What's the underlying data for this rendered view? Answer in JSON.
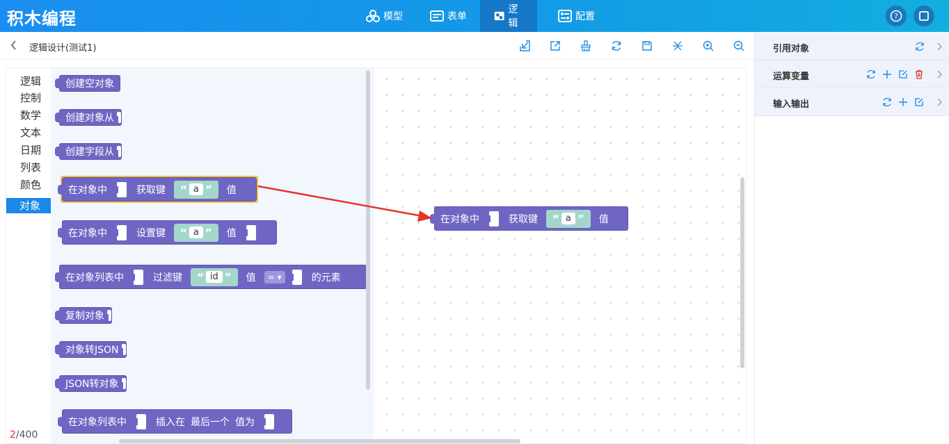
{
  "app": {
    "title": "积木编程"
  },
  "nav": {
    "tabs": [
      {
        "label": "模型",
        "icon": "model-icon"
      },
      {
        "label": "表单",
        "icon": "form-icon"
      },
      {
        "label": "逻辑",
        "icon": "logic-icon",
        "active": true
      },
      {
        "label": "配置",
        "icon": "config-icon"
      }
    ],
    "right_icons": [
      "help-icon",
      "fullscreen-icon"
    ]
  },
  "toolbar": {
    "breadcrumb": "逻辑设计(测试1)",
    "tools": [
      "import-icon",
      "export-icon",
      "clean-icon",
      "refresh-icon",
      "save-icon",
      "collapse-icon",
      "zoom-in-icon",
      "zoom-out-icon"
    ]
  },
  "categories": [
    {
      "label": "逻辑"
    },
    {
      "label": "控制"
    },
    {
      "label": "数学"
    },
    {
      "label": "文本"
    },
    {
      "label": "日期"
    },
    {
      "label": "列表"
    },
    {
      "label": "颜色"
    },
    {
      "label": "对象",
      "active": true
    }
  ],
  "blocks": {
    "create_empty": "创建空对象",
    "create_from": "创建对象从",
    "create_field_from": "创建字段从",
    "get_key": {
      "in_obj": "在对象中",
      "get_key": "获取键",
      "key": "a",
      "value": "值"
    },
    "set_key": {
      "in_obj": "在对象中",
      "set_key": "设置键",
      "key": "a",
      "value": "值"
    },
    "filter": {
      "in_list": "在对象列表中",
      "filter_key": "过滤键",
      "key": "id",
      "value": "值",
      "op": "=",
      "suffix": "的元素"
    },
    "copy": "复制对象",
    "to_json": "对象转JSON",
    "from_json": "JSON转对象",
    "insert": {
      "in_list": "在对象列表中",
      "insert_at": "插入在",
      "position": "最后一个",
      "value_as": "值为"
    },
    "placed": {
      "in_obj": "在对象中",
      "get_key": "获取键",
      "key": "a",
      "value": "值"
    }
  },
  "counter": {
    "used": "2",
    "total": "/400"
  },
  "right_panel": {
    "sections": [
      {
        "title": "引用对象"
      },
      {
        "title": "运算变量"
      },
      {
        "title": "输入输出"
      }
    ]
  },
  "colors": {
    "accent": "#1a88e6",
    "block": "#6f66c4",
    "string": "#a3d7cc",
    "arrow": "#e8322b",
    "selected": "#f4c042"
  }
}
